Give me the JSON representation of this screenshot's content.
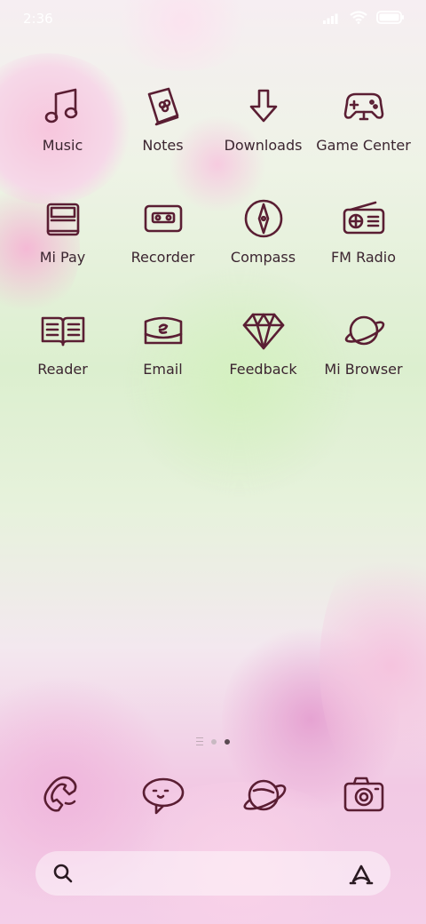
{
  "status_bar": {
    "time": "2:36"
  },
  "apps": [
    {
      "label": "Music",
      "icon": "music-icon"
    },
    {
      "label": "Notes",
      "icon": "notes-icon"
    },
    {
      "label": "Downloads",
      "icon": "download-icon"
    },
    {
      "label": "Game Center",
      "icon": "gamepad-icon"
    },
    {
      "label": "Mi Pay",
      "icon": "wallet-icon"
    },
    {
      "label": "Recorder",
      "icon": "cassette-icon"
    },
    {
      "label": "Compass",
      "icon": "compass-icon"
    },
    {
      "label": "FM Radio",
      "icon": "radio-icon"
    },
    {
      "label": "Reader",
      "icon": "book-icon"
    },
    {
      "label": "Email",
      "icon": "email-icon"
    },
    {
      "label": "Feedback",
      "icon": "diamond-icon"
    },
    {
      "label": "Mi Browser",
      "icon": "planet-icon"
    }
  ],
  "dock": [
    {
      "icon": "phone-icon"
    },
    {
      "icon": "chat-bubble-icon"
    },
    {
      "icon": "planet-icon"
    },
    {
      "icon": "camera-icon"
    }
  ],
  "search": {
    "left_icon": "search-icon",
    "right_icon": "assistant-icon"
  },
  "colors": {
    "icon_stroke": "#5a1e33",
    "label_text": "#3b2530"
  }
}
